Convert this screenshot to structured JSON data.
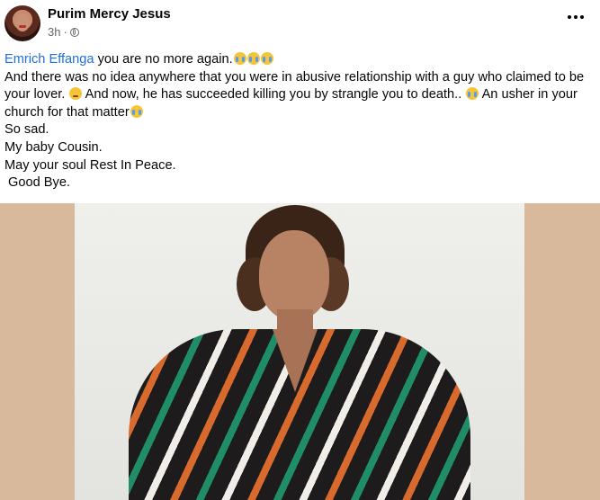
{
  "post": {
    "author": "Purim Mercy Jesus",
    "time": "3h",
    "separator": "·",
    "mention": "Emrich Effanga",
    "line1_rest": " you are no more again.",
    "line2": "And there was no idea anywhere that you were in abusive relationship with a guy who claimed to be your lover. ",
    "line2b": " And now, he has succeeded killing you by strangle you to death.. ",
    "line2c": " An usher in your church for that matter",
    "line3": "So sad.",
    "line4": "My baby Cousin.",
    "line5": "May your soul Rest In Peace.",
    "line6": " Good Bye."
  },
  "icons": {
    "avatar": "profile-photo",
    "privacy": "globe-icon",
    "more": "more-options-icon",
    "emoji_cry": "crying-face-emoji",
    "emoji_sad": "disappointed-face-emoji"
  },
  "colors": {
    "mention": "#216fdb",
    "meta": "#65676b",
    "photo_border": "#d9b99c"
  }
}
